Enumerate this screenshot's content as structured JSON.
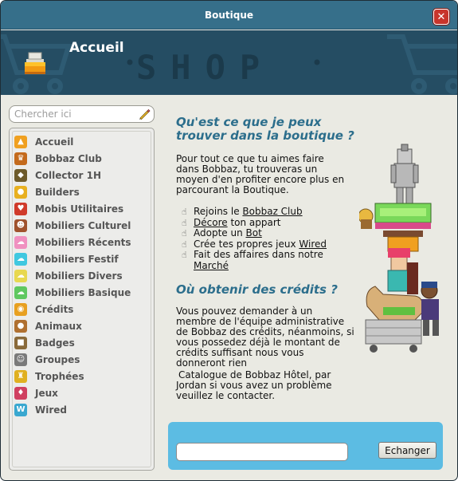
{
  "window": {
    "title": "Boutique",
    "close_label": "✕"
  },
  "header": {
    "title": "Accueil",
    "banner_text": "SHOP"
  },
  "search": {
    "placeholder": "Chercher ici"
  },
  "sidebar": {
    "items": [
      {
        "label": "Accueil",
        "icon": "cart-icon",
        "color": "#f0a020"
      },
      {
        "label": "Bobbaz Club",
        "icon": "club-icon",
        "color": "#c46a1c"
      },
      {
        "label": "Collector 1H",
        "icon": "leaf-icon",
        "color": "#6d5a2a"
      },
      {
        "label": "Builders",
        "icon": "hardhat-icon",
        "color": "#e8b020"
      },
      {
        "label": "Mobis Utilitaires",
        "icon": "heart-icon",
        "color": "#d03a2a"
      },
      {
        "label": "Mobiliers Culturel",
        "icon": "culture-icon",
        "color": "#a0522d"
      },
      {
        "label": "Mobiliers Récents",
        "icon": "cloud-pink-icon",
        "color": "#f090c0"
      },
      {
        "label": "Mobiliers Festif",
        "icon": "cloud-cyan-icon",
        "color": "#40c8e0"
      },
      {
        "label": "Mobiliers Divers",
        "icon": "cloud-yellow-icon",
        "color": "#e8d850"
      },
      {
        "label": "Mobiliers Basique",
        "icon": "cloud-green-icon",
        "color": "#60c860"
      },
      {
        "label": "Crédits",
        "icon": "coins-icon",
        "color": "#e8a020"
      },
      {
        "label": "Animaux",
        "icon": "pet-icon",
        "color": "#b07030"
      },
      {
        "label": "Badges",
        "icon": "badge-icon",
        "color": "#8a6a3a"
      },
      {
        "label": "Groupes",
        "icon": "group-icon",
        "color": "#7a7a7a"
      },
      {
        "label": "Trophées",
        "icon": "trophy-icon",
        "color": "#e0b020"
      },
      {
        "label": "Jeux",
        "icon": "joystick-icon",
        "color": "#d04060"
      },
      {
        "label": "Wired",
        "icon": "wired-icon",
        "color": "#3aa8d0"
      }
    ]
  },
  "content": {
    "heading1": "Qu'est ce que je peux trouver dans la boutique ?",
    "intro": "Pour tout ce que tu aimes faire dans Bobbaz, tu trouveras un moyen d'en profiter encore plus en parcourant la Boutique.",
    "bullets": [
      {
        "pre": "Rejoins le ",
        "link": "Bobbaz Club",
        "post": ""
      },
      {
        "pre": "",
        "link": "Décore",
        "post": " ton appart"
      },
      {
        "pre": "Adopte un ",
        "link": "Bot",
        "post": ""
      },
      {
        "pre": "Crée tes propres jeux ",
        "link": "Wired",
        "post": ""
      },
      {
        "pre": "Fait des affaires dans notre ",
        "link": "Marché",
        "post": ""
      }
    ],
    "heading2": "Où obtenir des crédits ?",
    "credits_text": "Vous pouvez demander à un membre de l'équipe administrative de Bobbaz des crédits, néanmoins, si vous possedez déjà le montant de crédits suffisant nous vous donneront rien",
    "footer_text": "Catalogue de Bobbaz Hôtel, par Jordan si vous avez un problème veuillez le contacter."
  },
  "voucher": {
    "input_value": "",
    "button_label": "Echanger"
  },
  "colors": {
    "title_bar": "#366f8a",
    "header_bg": "#254d63",
    "heading": "#2c6e8c",
    "panel_blue": "#5cbce3",
    "close_red": "#c8352c"
  }
}
